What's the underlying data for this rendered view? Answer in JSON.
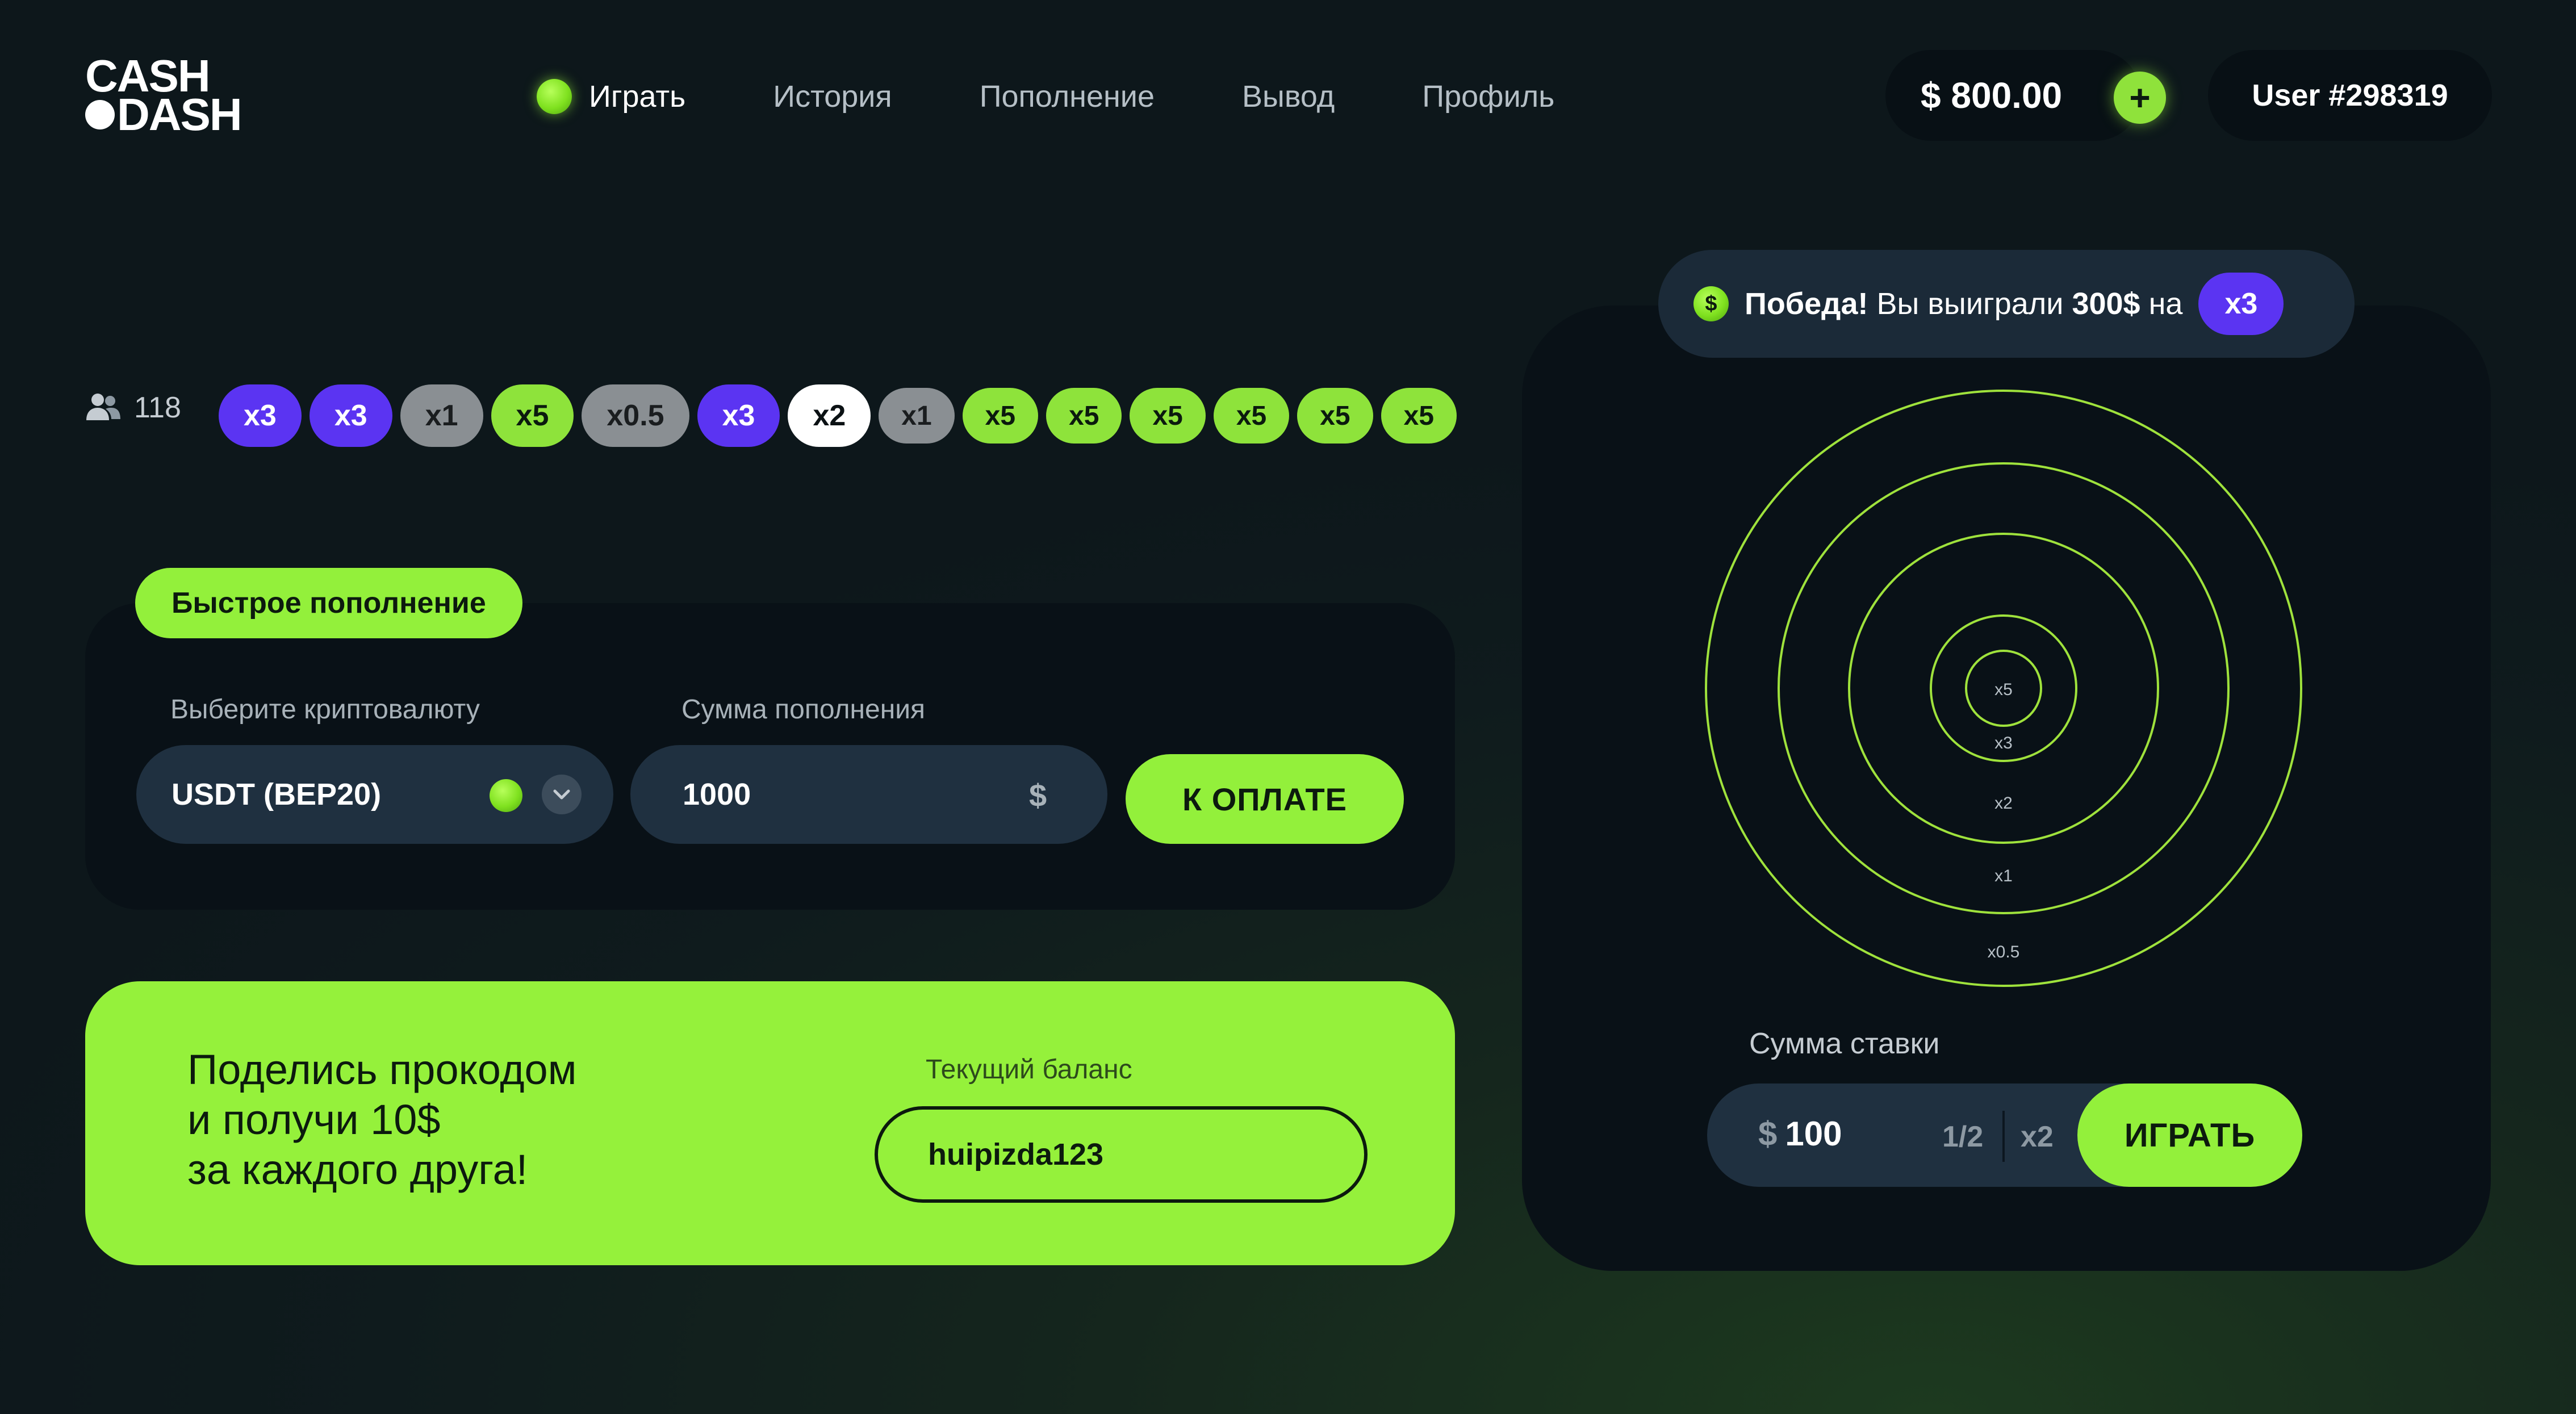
{
  "brand": {
    "line1": "CASH",
    "line2": "DASH"
  },
  "nav": [
    {
      "label": "Играть",
      "active": true
    },
    {
      "label": "История"
    },
    {
      "label": "Пополнение"
    },
    {
      "label": "Вывод"
    },
    {
      "label": "Профиль"
    }
  ],
  "header": {
    "balance": "$ 800.00",
    "add_label": "+",
    "user": "User #298319"
  },
  "history": {
    "online_count": "118",
    "multipliers": [
      {
        "label": "x3",
        "color": "purple"
      },
      {
        "label": "x3",
        "color": "purple"
      },
      {
        "label": "x1",
        "color": "grey"
      },
      {
        "label": "x5",
        "color": "green"
      },
      {
        "label": "x0.5",
        "color": "grey"
      },
      {
        "label": "x3",
        "color": "purple"
      },
      {
        "label": "x2",
        "color": "white"
      },
      {
        "label": "x1",
        "color": "grey"
      },
      {
        "label": "x5",
        "color": "green"
      },
      {
        "label": "x5",
        "color": "green"
      },
      {
        "label": "x5",
        "color": "green"
      },
      {
        "label": "x5",
        "color": "green"
      },
      {
        "label": "x5",
        "color": "green"
      },
      {
        "label": "x5",
        "color": "green"
      }
    ]
  },
  "quick_topup": {
    "tab_label": "Быстрое пополнение",
    "crypto_label": "Выберите криптовалюту",
    "crypto_value": "USDT (BEP20)",
    "amount_label": "Сумма пополнения",
    "amount_value": "1000",
    "currency": "$",
    "pay_button": "К ОПЛАТЕ"
  },
  "promo": {
    "line1": "Поделись прокодом",
    "line2": "и получи 10$",
    "line3": "за каждого друга!",
    "field_label": "Текущий баланс",
    "code": "huipizda123"
  },
  "game": {
    "notification": {
      "coin": "$",
      "win": "Победа!",
      "text": "Вы выиграли",
      "amount": "300$",
      "on": "на",
      "multiplier": "x3"
    },
    "rings": [
      "x5",
      "x3",
      "x2",
      "x1",
      "x0.5"
    ],
    "stake_label": "Сумма ставки",
    "stake_currency": "$",
    "stake_value": "100",
    "half_label": "1/2",
    "double_label": "x2",
    "play_button": "ИГРАТЬ"
  },
  "colors": {
    "accent": "#93f03b",
    "purple": "#5b34f2",
    "grey": "#8a8f93",
    "panel": "#091117",
    "field": "#1f3040"
  }
}
